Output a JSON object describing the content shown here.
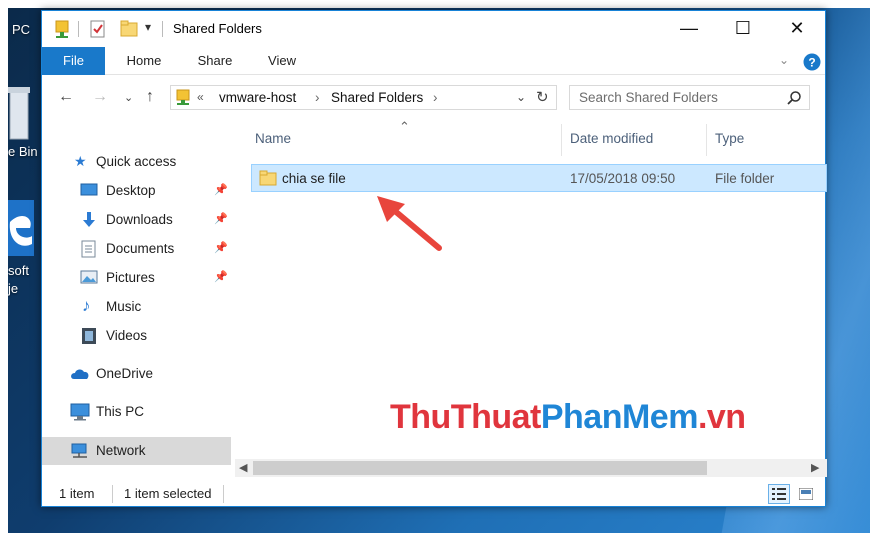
{
  "desktop": {
    "labels": {
      "this_pc": "PC",
      "recycle_bin": "e Bin",
      "edge_line1": "soft",
      "edge_line2": "je"
    }
  },
  "window": {
    "title": "Shared Folders",
    "controls": {
      "minimize": "—",
      "maximize": "☐",
      "close": "✕"
    }
  },
  "ribbon": {
    "tabs": [
      "File",
      "Home",
      "Share",
      "View"
    ]
  },
  "address": {
    "overflow": "«",
    "crumbs": [
      "vmware-host",
      "Shared Folders"
    ],
    "separator": "›"
  },
  "search": {
    "placeholder": "Search Shared Folders"
  },
  "nav": {
    "quick_access": "Quick access",
    "items": [
      "Desktop",
      "Downloads",
      "Documents",
      "Pictures",
      "Music",
      "Videos"
    ],
    "onedrive": "OneDrive",
    "this_pc": "This PC",
    "network": "Network"
  },
  "columns": {
    "name": "Name",
    "date": "Date modified",
    "type": "Type"
  },
  "files": [
    {
      "name": "chia se file",
      "date": "17/05/2018 09:50",
      "type": "File folder"
    }
  ],
  "status": {
    "count": "1 item",
    "selected": "1 item selected"
  },
  "watermark": {
    "part1": "ThuThuat",
    "part2": "PhanMem",
    "part3": ".vn"
  },
  "colors": {
    "accent": "#1979ca",
    "selection": "#cce8ff",
    "watermark_red": "#e0353d",
    "watermark_blue": "#1f86d6",
    "arrow": "#e8453c"
  }
}
